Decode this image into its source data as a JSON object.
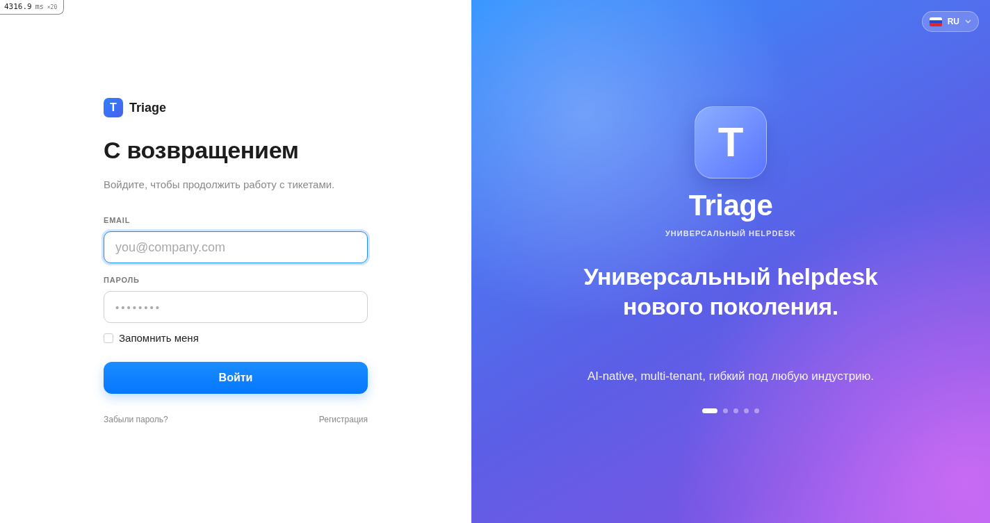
{
  "debug_badge": {
    "time": "4316.9",
    "unit": "ms",
    "count": "×20"
  },
  "login": {
    "brand": {
      "logo_letter": "T",
      "name": "Triage"
    },
    "title": "С возвращением",
    "subtitle": "Войдите, чтобы продолжить работу с тикетами.",
    "fields": [
      {
        "kind": "email",
        "label": "EMAIL",
        "placeholder": "you@company.com",
        "focused": true
      },
      {
        "kind": "password",
        "label": "ПАРОЛЬ",
        "placeholder": "••••••••",
        "focused": false
      }
    ],
    "remember": {
      "label": "Запомнить меня",
      "checked": false
    },
    "submit": "Войти",
    "links": [
      {
        "label": "Забыли пароль?"
      },
      {
        "label": "Регистрация"
      }
    ]
  },
  "promo": {
    "language": {
      "code": "RU"
    },
    "logo_letter": "T",
    "name": "Triage",
    "eyebrow": "УНИВЕРСАЛЬНЫЙ HELPDESK",
    "headline": "Универсальный helpdesk нового поколения.",
    "tagline": "AI-native, multi-tenant, гибкий под любую индустрию.",
    "slides": [
      {
        "selected": true
      },
      {
        "selected": false
      },
      {
        "selected": false
      },
      {
        "selected": false
      },
      {
        "selected": false
      }
    ]
  }
}
